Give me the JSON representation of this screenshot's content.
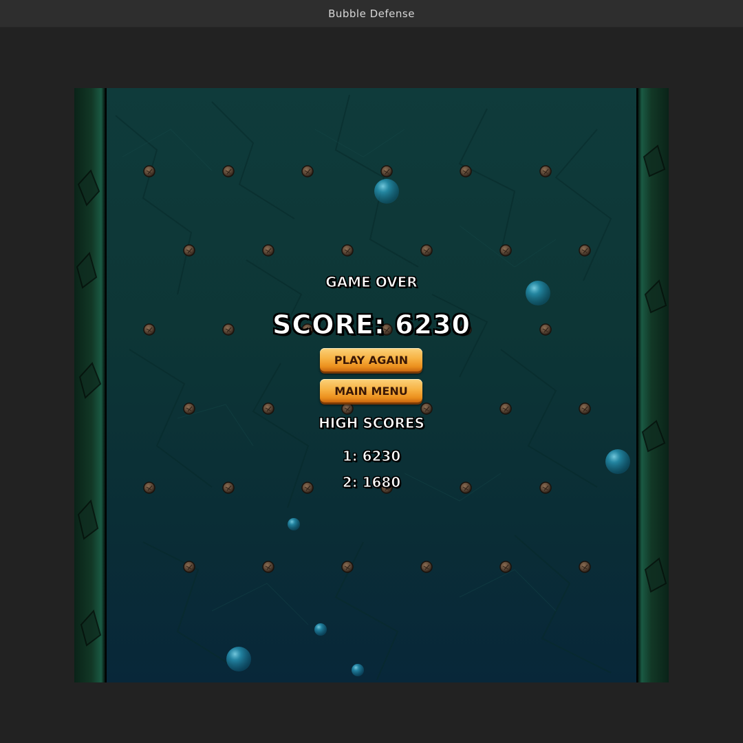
{
  "window": {
    "title": "Bubble Defense"
  },
  "game_over": {
    "title": "GAME OVER",
    "score": "SCORE: 6230",
    "buttons": {
      "play_again": "PLAY AGAIN",
      "main_menu": "MAIN MENU"
    },
    "high_scores": {
      "title": "HIGH SCORES",
      "entries": [
        "1: 6230",
        "2: 1680"
      ]
    }
  },
  "colors": {
    "background": "#222222",
    "water_top": "#0f3b3b",
    "water_bottom": "#082739",
    "button_gold": "#f7b243",
    "button_text": "#3a1706",
    "bubble": "#1f8fb0",
    "peg": "#5a4636"
  }
}
